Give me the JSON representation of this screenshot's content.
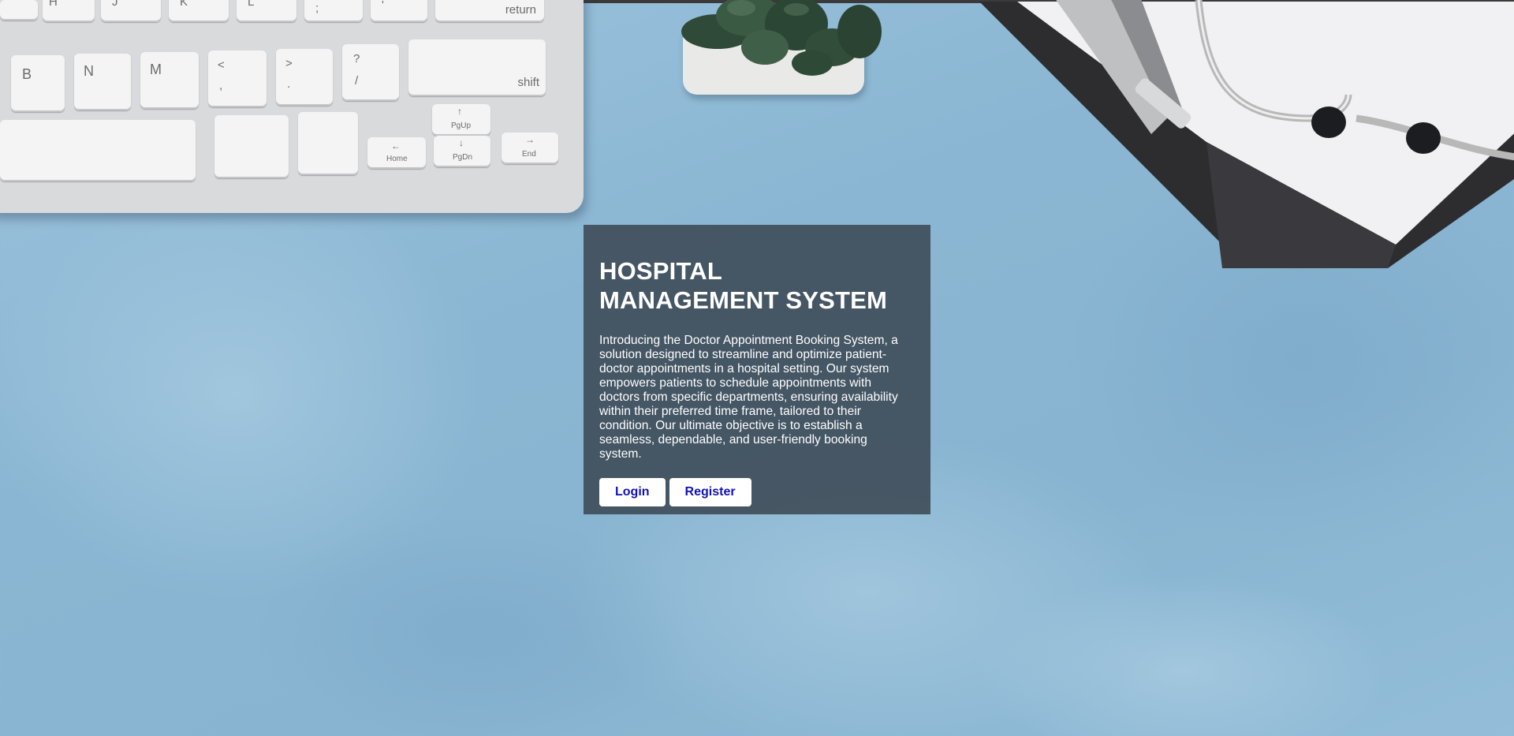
{
  "hero": {
    "title": "HOSPITAL MANAGEMENT SYSTEM",
    "description": "Introducing the Doctor Appointment Booking System, a solution designed to streamline and optimize patient-doctor appointments in a hospital setting. Our system empowers patients to schedule appointments with doctors from specific departments, ensuring availability within their preferred time frame, tailored to their condition. Our ultimate objective is to establish a seamless, dependable, and user-friendly booking system.",
    "login_label": "Login",
    "register_label": "Register"
  },
  "keyboard": {
    "keys": {
      "h": "H",
      "j": "J",
      "k": "K",
      "l": "L",
      "semicolon": ";",
      "quote": "'",
      "return": "return",
      "b": "B",
      "n": "N",
      "m": "M",
      "comma_top": "<",
      "comma_bottom": ",",
      "period_top": ">",
      "period_bottom": ".",
      "slash_top": "?",
      "slash_bottom": "/",
      "shift": "shift",
      "pgup": "PgUp",
      "pgdn": "PgDn",
      "home": "Home",
      "end": "End",
      "arrow_up": "↑",
      "arrow_down": "↓",
      "arrow_left": "←",
      "arrow_right": "→"
    }
  },
  "colors": {
    "background": "#8ab6d3",
    "card": "#3a4652",
    "button_text": "#1212b5"
  }
}
